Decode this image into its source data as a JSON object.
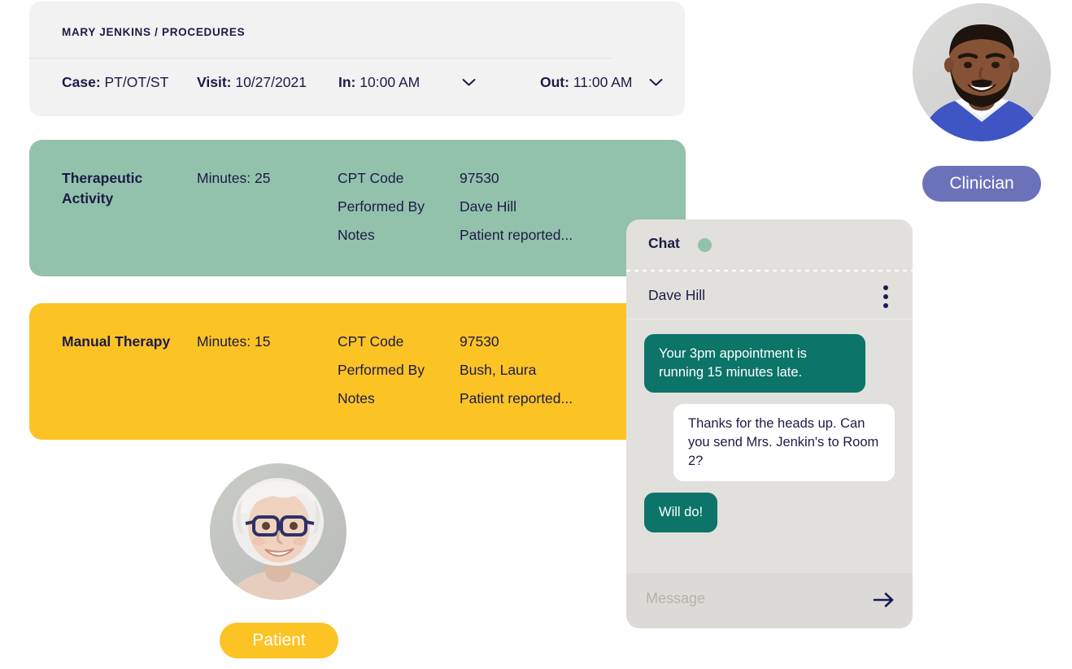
{
  "visit": {
    "breadcrumb": "MARY JENKINS / PROCEDURES",
    "fields": {
      "case_label": "Case:",
      "case_value": "PT/OT/ST",
      "visit_label": "Visit:",
      "visit_value": "10/27/2021",
      "in_label": "In:",
      "in_value": "10:00 AM",
      "out_label": "Out:",
      "out_value": "11:00 AM"
    },
    "in_dropdown_icon": "chevron-down-icon",
    "out_dropdown_icon": "chevron-down-icon"
  },
  "procedures": [
    {
      "name": "Therapeutic Activity",
      "minutes": "Minutes: 25",
      "color": "#93c2ac",
      "rows": [
        {
          "key": "CPT Code",
          "value": "97530"
        },
        {
          "key": "Performed By",
          "value": "Dave Hill"
        },
        {
          "key": "Notes",
          "value": "Patient reported..."
        }
      ]
    },
    {
      "name": "Manual Therapy",
      "minutes": "Minutes: 15",
      "color": "#fcc325",
      "rows": [
        {
          "key": "CPT Code",
          "value": "97530"
        },
        {
          "key": "Performed By",
          "value": "Bush, Laura"
        },
        {
          "key": "Notes",
          "value": "Patient reported..."
        }
      ]
    }
  ],
  "chat": {
    "title": "Chat",
    "status_dot_color": "#93c2ac",
    "contact": "Dave Hill",
    "menu_icon": "kebab-menu-icon",
    "messages": [
      {
        "from": "them",
        "text": "Your 3pm appointment is running 15 minutes late."
      },
      {
        "from": "me",
        "text": "Thanks for the heads up. Can you send Mrs. Jenkin's to Room 2?"
      },
      {
        "from": "them",
        "text": "Will do!"
      }
    ],
    "input": {
      "value": "",
      "placeholder": "Message",
      "send_icon": "arrow-right-icon"
    },
    "bubble_them_color": "#0c7468",
    "bubble_me_color": "#ffffff"
  },
  "personas": [
    {
      "role": "Clinician",
      "badge_color": "#6c72b9",
      "avatar_name": "clinician-avatar"
    },
    {
      "role": "Patient",
      "badge_color": "#fcc325",
      "avatar_name": "patient-avatar"
    }
  ]
}
